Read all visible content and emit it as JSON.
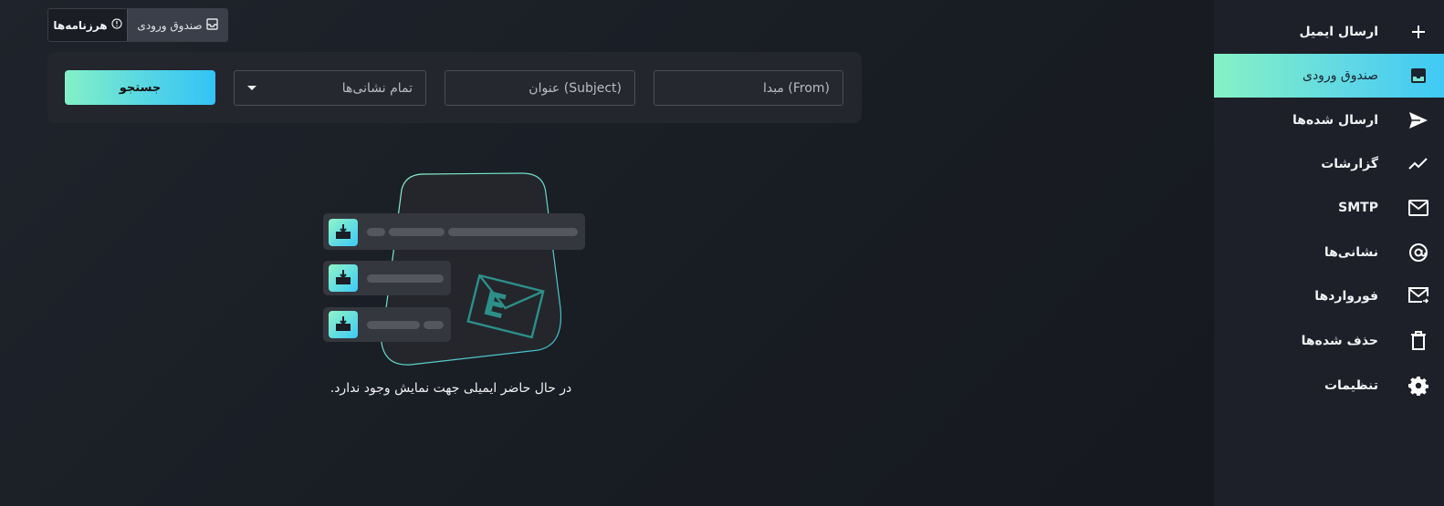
{
  "sidebar": {
    "items": [
      {
        "label": "ارسال ایمیل",
        "icon": "plus-icon"
      },
      {
        "label": "صندوق ورودی",
        "icon": "inbox-icon",
        "active": true
      },
      {
        "label": "ارسال شده‌ها",
        "icon": "send-icon"
      },
      {
        "label": "گزارشات",
        "icon": "chart-line-icon"
      },
      {
        "label": "SMTP",
        "icon": "envelope-icon"
      },
      {
        "label": "نشانی‌ها",
        "icon": "at-icon"
      },
      {
        "label": "فورواردها",
        "icon": "forward-mail-icon"
      },
      {
        "label": "حذف شده‌ها",
        "icon": "trash-icon"
      },
      {
        "label": "تنظیمات",
        "icon": "gear-icon"
      }
    ]
  },
  "top_tabs": {
    "spam_label": "هرزنامه‌ها",
    "inbox_label": "صندوق ورودی"
  },
  "filters": {
    "from_placeholder": "مبدا (From)",
    "subject_placeholder": "عنوان (Subject)",
    "address_selected": "تمام نشانی‌ها",
    "search_label": "جستجو"
  },
  "empty_state": {
    "message": "در حال حاضر ایمیلی جهت نمایش وجود ندارد."
  },
  "colors": {
    "accent_start": "#86f2c4",
    "accent_end": "#3ec9f5",
    "sidebar_bg": "#1d2028"
  }
}
